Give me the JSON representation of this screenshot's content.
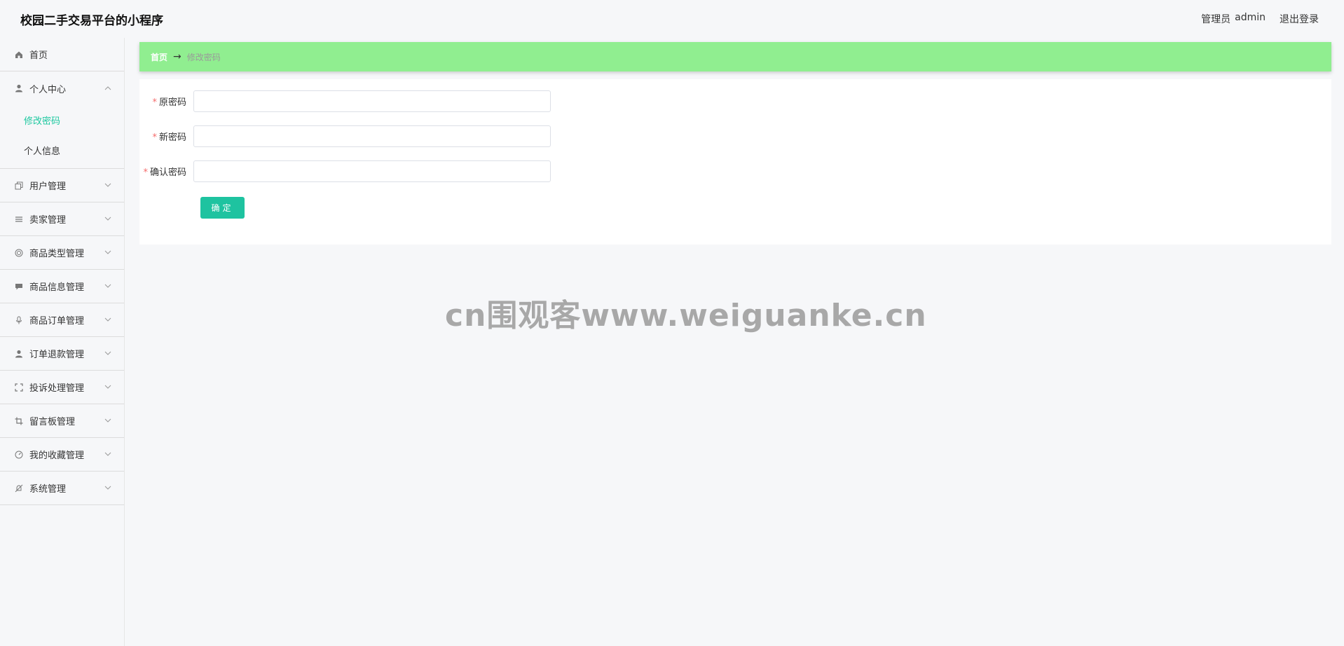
{
  "header": {
    "app_title": "校园二手交易平台的小程序",
    "user_role": "管理员",
    "username": "admin",
    "logout_label": "退出登录"
  },
  "sidebar": {
    "items": [
      {
        "label": "首页",
        "icon": "home-icon"
      },
      {
        "label": "个人中心",
        "icon": "user-icon",
        "expanded": true,
        "children": [
          {
            "label": "修改密码",
            "active": true
          },
          {
            "label": "个人信息",
            "active": false
          }
        ]
      },
      {
        "label": "用户管理",
        "icon": "copy-icon"
      },
      {
        "label": "卖家管理",
        "icon": "list-icon"
      },
      {
        "label": "商品类型管理",
        "icon": "target-icon"
      },
      {
        "label": "商品信息管理",
        "icon": "message-icon"
      },
      {
        "label": "商品订单管理",
        "icon": "microphone-icon"
      },
      {
        "label": "订单退款管理",
        "icon": "person-icon"
      },
      {
        "label": "投诉处理管理",
        "icon": "fullscreen-icon"
      },
      {
        "label": "留言板管理",
        "icon": "crop-icon"
      },
      {
        "label": "我的收藏管理",
        "icon": "gauge-icon"
      },
      {
        "label": "系统管理",
        "icon": "bell-off-icon"
      }
    ]
  },
  "breadcrumb": {
    "home": "首页",
    "separator": "→",
    "current": "修改密码"
  },
  "form": {
    "fields": [
      {
        "label": "原密码",
        "required_mark": "*",
        "value": ""
      },
      {
        "label": "新密码",
        "required_mark": "*",
        "value": ""
      },
      {
        "label": "确认密码",
        "required_mark": "*",
        "value": ""
      }
    ],
    "submit_label": "确定"
  },
  "watermark": "cn围观客www.weiguanke.cn",
  "colors": {
    "accent": "#1ec3a0",
    "breadcrumb_bg": "#90ee90",
    "required": "#f56c6c"
  }
}
